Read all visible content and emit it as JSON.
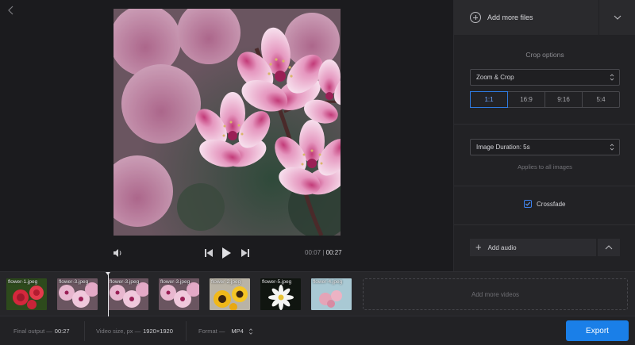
{
  "preview": {
    "back_icon": "chevron-left-icon",
    "current_time": "00:07",
    "total_time": "00:27",
    "icons": [
      "volume-icon",
      "skip-back-icon",
      "play-icon",
      "skip-forward-icon"
    ]
  },
  "panel": {
    "add_files_label": "Add more files",
    "crop_title": "Crop options",
    "crop_mode": "Zoom & Crop",
    "ratios": [
      "1:1",
      "16:9",
      "9:16",
      "5:4"
    ],
    "active_ratio": "1:1",
    "image_duration": "Image Duration: 5s",
    "applies_hint": "Applies to all images",
    "crossfade_label": "Crossfade",
    "crossfade_checked": true,
    "add_audio_label": "Add audio"
  },
  "timeline": {
    "clips": [
      {
        "name": "flower-1.jpeg"
      },
      {
        "name": "flower-3.jpeg"
      },
      {
        "name": "flower-3.jpeg"
      },
      {
        "name": "flower-3.jpeg"
      },
      {
        "name": "flower-2.jpeg"
      },
      {
        "name": "flower-5.jpeg"
      },
      {
        "name": "flower-4.jpeg"
      }
    ],
    "add_videos_label": "Add more videos"
  },
  "footer": {
    "final_output_label": "Final output —",
    "final_output_value": "00:27",
    "video_size_label": "Video size, px —",
    "video_size_value": "1920×1920",
    "format_label": "Format —",
    "format_value": "MP4",
    "export_label": "Export"
  },
  "colors": {
    "accent": "#1a7fe8",
    "background": "#1b1b1e",
    "panel": "#222225"
  }
}
